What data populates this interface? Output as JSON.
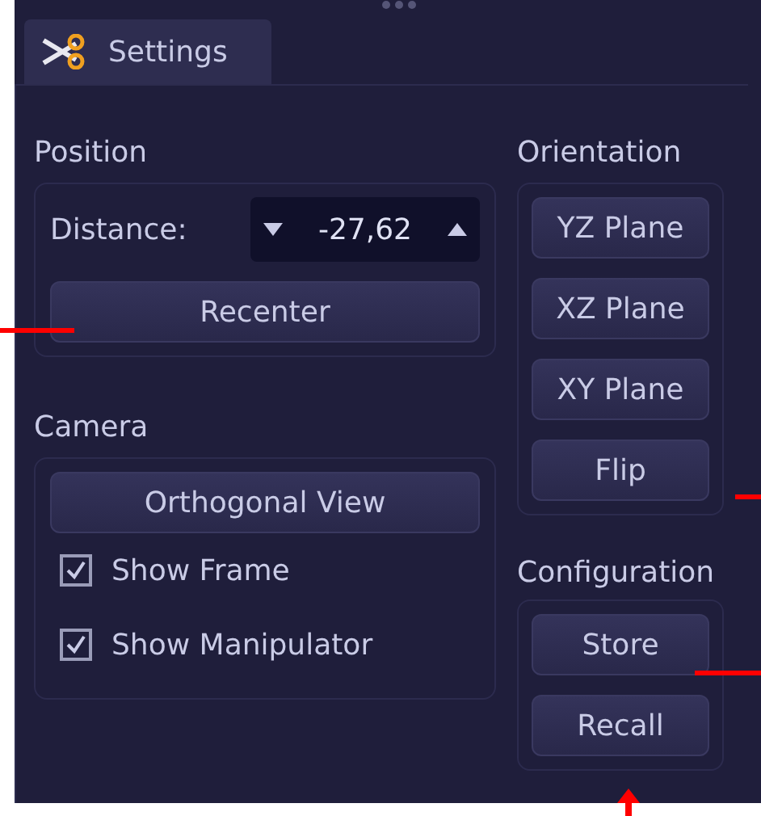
{
  "tab": {
    "label": "Settings",
    "selected": true
  },
  "position": {
    "title": "Position",
    "distance_label": "Distance:",
    "distance_value": "-27,62",
    "button": "Recenter"
  },
  "camera": {
    "title": "Camera",
    "button": "Orthogonal View",
    "options": [
      {
        "label": "Show Frame",
        "checked": true
      },
      {
        "label": "Show Manipulator",
        "checked": true
      }
    ]
  },
  "orientation": {
    "title": "Orientation",
    "buttons": [
      "YZ Plane",
      "XZ Plane",
      "XY Plane",
      "Flip"
    ]
  },
  "configuration": {
    "title": "Configuration",
    "buttons": [
      "Store",
      "Recall"
    ]
  }
}
